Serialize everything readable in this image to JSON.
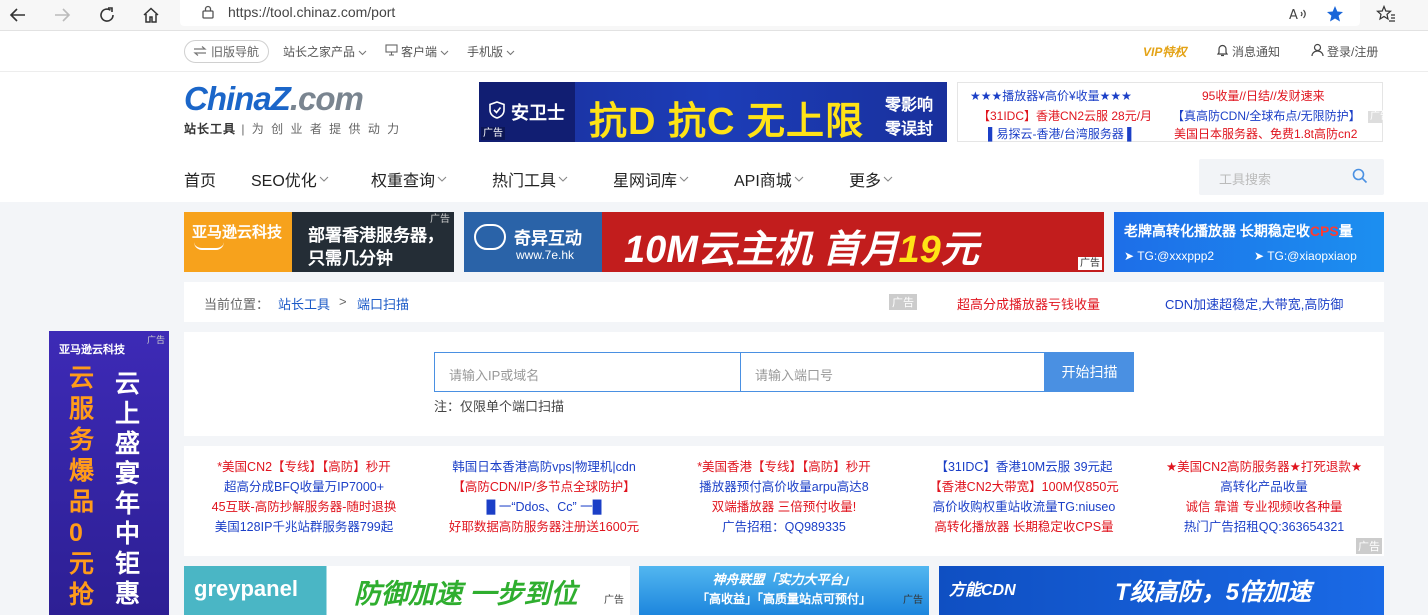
{
  "browser": {
    "url": "https://tool.chinaz.com/port"
  },
  "topbar": {
    "old_nav": "旧版导航",
    "products": "站长之家产品",
    "client": "客户端",
    "mobile": "手机版",
    "vip": "VIP特权",
    "notify": "消息通知",
    "login": "登录/注册"
  },
  "header": {
    "logo_main": "ChinaZ",
    "logo_dotcom": ".com",
    "slogan_bold": "站长工具",
    "slogan_rest": "| 为 创 业 者 提 供 动 力"
  },
  "top_ad": {
    "brand": "安卫士",
    "headline": "抗D 抗C 无上限",
    "right1": "零影响",
    "right2": "零误封",
    "tag": "广告"
  },
  "text_ad": {
    "l1": "★★★播放器¥高价¥收量★★★",
    "l2": "【31IDC】香港CN2云服 28元/月",
    "l3": "▌易探云-香港/台湾服务器 ▌",
    "r1": "95收量//日结//发财速来",
    "r2": "【真高防CDN/全球布点/无限防护】",
    "r3": "美国日本服务器、免费1.8t高防cn2",
    "tag": "广告"
  },
  "nav": {
    "home": "首页",
    "seo": "SEO优化",
    "weight": "权重查询",
    "hot": "热门工具",
    "words": "星网词库",
    "api": "API商城",
    "more": "更多",
    "search_placeholder": "工具搜索"
  },
  "banners": {
    "aws_brand": "亚马逊云科技",
    "aws_text1": "部署香港服务器，",
    "aws_text2": "只需几分钟",
    "qiyi_brand": "奇异互动",
    "qiyi_site": "www.7e.hk",
    "qiyi_headline_a": "10M云主机  首月",
    "qiyi_headline_b": "19",
    "qiyi_headline_c": "元",
    "cps_title_a": "老牌高转化播放器 长期稳定收",
    "cps_title_b": "CPS",
    "cps_title_c": "量",
    "cps_tg1": "TG:@xxxppp2",
    "cps_tg2": "TG:@xiaopxiaop",
    "tag": "广告"
  },
  "breadcrumb": {
    "prefix": "当前位置：",
    "home": "站长工具",
    "sep": ">",
    "current": "端口扫描",
    "tag": "广告",
    "ad1": "超高分成播放器亏钱收量",
    "ad2": "CDN加速超稳定,大带宽,高防御"
  },
  "side_banner": {
    "brand": "亚马逊云科技",
    "col1": "云服务爆品0元抢",
    "col2": "云上盛宴年中钜惠",
    "tag": "广告"
  },
  "tool": {
    "ip_placeholder": "请输入IP或域名",
    "port_placeholder": "请输入端口号",
    "scan_button": "开始扫描",
    "note": "注：仅限单个端口扫描"
  },
  "text_ads": [
    [
      "*美国CN2【专线】【高防】秒开",
      "超高分成BFQ收量万IP7000+",
      "45互联-高防抄解服务器-随时退换",
      "美国128IP千兆站群服务器799起"
    ],
    [
      "韩国日本香港高防vps|物理机|cdn",
      "【高防CDN/IP/多节点全球防护】",
      "█ 一“Ddos、Cc” 一█",
      "好耶数据高防服务器注册送1600元"
    ],
    [
      "*美国香港【专线】【高防】秒开",
      "播放器预付高价收量arpu高达8",
      "双端播放器 三倍预付收量!",
      "广告招租：QQ989335"
    ],
    [
      "【31IDC】香港10M云服 39元起",
      "【香港CN2大带宽】100M仅850元",
      "高价收购权重站收流量TG:niuseo",
      "高转化播放器 长期稳定收CPS量"
    ],
    [
      "★美国CN2高防服务器★打死退款★",
      "高转化产品收量",
      "诚信 靠谱 专业视频收各种量",
      "热门广告招租QQ:363654321"
    ]
  ],
  "text_ads_tag": "广告",
  "bottom_banners": {
    "grey_brand": "greypanel",
    "grey_text": "防御加速 一步到位",
    "shenzhou_1": "神舟联盟「实力大平台」",
    "shenzhou_2": "「高收益」「高质量站点可预付」",
    "fangneng_brand": "方能CDN",
    "fangneng_text": "T级高防，5倍加速",
    "tag": "广告"
  },
  "colors": {
    "brand_blue": "#1b66c9",
    "link_blue": "#1b5ac7",
    "ad_red": "#e0141e",
    "button_blue": "#4a90e2"
  }
}
